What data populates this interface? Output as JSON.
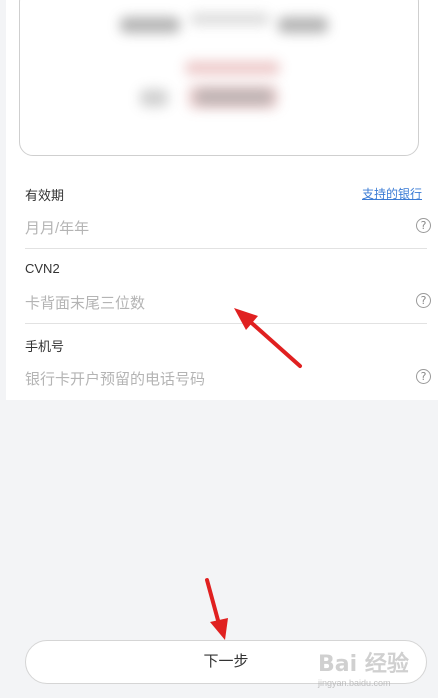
{
  "form": {
    "expiry": {
      "label": "有效期",
      "placeholder": "月月/年年",
      "help_icon": "?"
    },
    "supported_banks_link": "支持的银行",
    "cvn2": {
      "label": "CVN2",
      "placeholder": "卡背面末尾三位数",
      "help_icon": "?"
    },
    "phone": {
      "label": "手机号",
      "placeholder": "银行卡开户预留的电话号码",
      "help_icon": "?"
    }
  },
  "footer": {
    "next_label": "下一步"
  },
  "watermark": {
    "brand": "Bai 经验",
    "sub": "jingyan.baidu.com"
  },
  "icons": {
    "help": "question-circle-icon",
    "annotation": "red-arrow-icon"
  },
  "colors": {
    "link": "#3a7bd5",
    "annotation": "#e02020"
  }
}
